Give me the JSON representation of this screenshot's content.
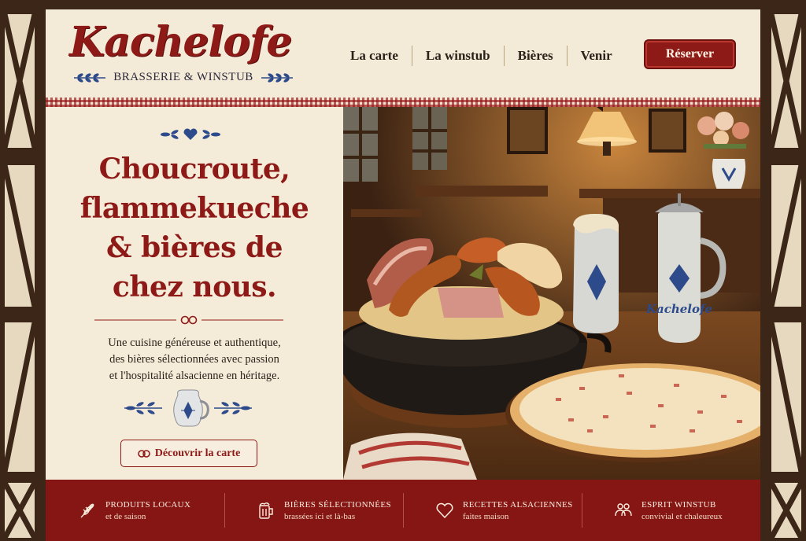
{
  "brand": {
    "name": "Kachelofe",
    "tagline": "BRASSERIE & WINSTUB"
  },
  "nav": {
    "items": [
      {
        "label": "La carte"
      },
      {
        "label": "La winstub"
      },
      {
        "label": "Bières"
      },
      {
        "label": "Venir"
      }
    ],
    "reserve_label": "Réserver"
  },
  "hero": {
    "headline_lines": [
      "Choucroute,",
      "flammekueche",
      "& bières de",
      "chez nous."
    ],
    "intro_lines": [
      "Une cuisine généreuse et authentique,",
      "des bières sélectionnées avec passion",
      "et l'hospitalité alsacienne en héritage."
    ],
    "cta_label": "Découvrir la carte",
    "jug_text": "Kachelofe"
  },
  "features": [
    {
      "title": "PRODUITS LOCAUX",
      "subtitle": "et de saison",
      "icon": "wheat-icon"
    },
    {
      "title": "BIÈRES SÉLECTIONNÉES",
      "subtitle": "brassées ici et là-bas",
      "icon": "beer-mug-icon"
    },
    {
      "title": "RECETTES ALSACIENNES",
      "subtitle": "faites maison",
      "icon": "heart-icon"
    },
    {
      "title": "ESPRIT WINSTUB",
      "subtitle": "convivial et chaleureux",
      "icon": "people-icon"
    }
  ],
  "colors": {
    "accent": "#8e1a17",
    "cream": "#f4ead8",
    "timber": "#3b2617",
    "blue_motif": "#2d4a8a"
  }
}
